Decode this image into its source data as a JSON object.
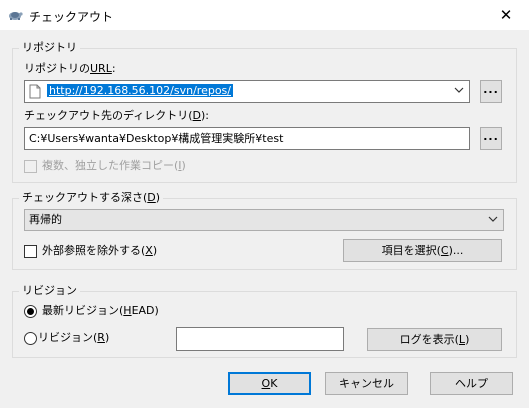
{
  "window": {
    "title": "チェックアウト",
    "close_glyph": "✕"
  },
  "repo_group": {
    "legend": "リポジトリ",
    "url_label_prefix": "リポジトリの",
    "url_label_key": "URL",
    "url_label_suffix": ":",
    "url_value": "http://192.168.56.102/svn/repos/",
    "url_browse": "...",
    "dir_label_prefix": "チェックアウト先のディレクトリ(",
    "dir_label_key": "D",
    "dir_label_suffix": "):",
    "dir_value": "C:¥Users¥wanta¥Desktop¥構成管理実験所¥test",
    "dir_browse": "...",
    "independent_prefix": "複数、独立した作業コピー(",
    "independent_key": "I",
    "independent_suffix": ")"
  },
  "depth_group": {
    "legend_prefix": "チェックアウトする深さ(",
    "legend_key": "D",
    "legend_suffix": ")",
    "depth_value": "再帰的",
    "externals_prefix": "外部参照を除外する(",
    "externals_key": "X",
    "externals_suffix": ")",
    "select_items_prefix": "項目を選択(",
    "select_items_key": "C",
    "select_items_suffix": ")..."
  },
  "revision_group": {
    "legend": "リビジョン",
    "head_prefix": "最新リビジョン(",
    "head_key": "H",
    "head_suffix": "EAD)",
    "rev_prefix": "リビジョン(",
    "rev_key": "R",
    "rev_suffix": ")",
    "rev_value": "",
    "show_log_prefix": "ログを表示(",
    "show_log_key": "L",
    "show_log_suffix": ")"
  },
  "footer": {
    "ok_key": "O",
    "ok_rest": "K",
    "cancel": "キャンセル",
    "help": "ヘルプ"
  },
  "colors": {
    "accent": "#0078d7",
    "dialog_bg": "#f0f0f0"
  }
}
